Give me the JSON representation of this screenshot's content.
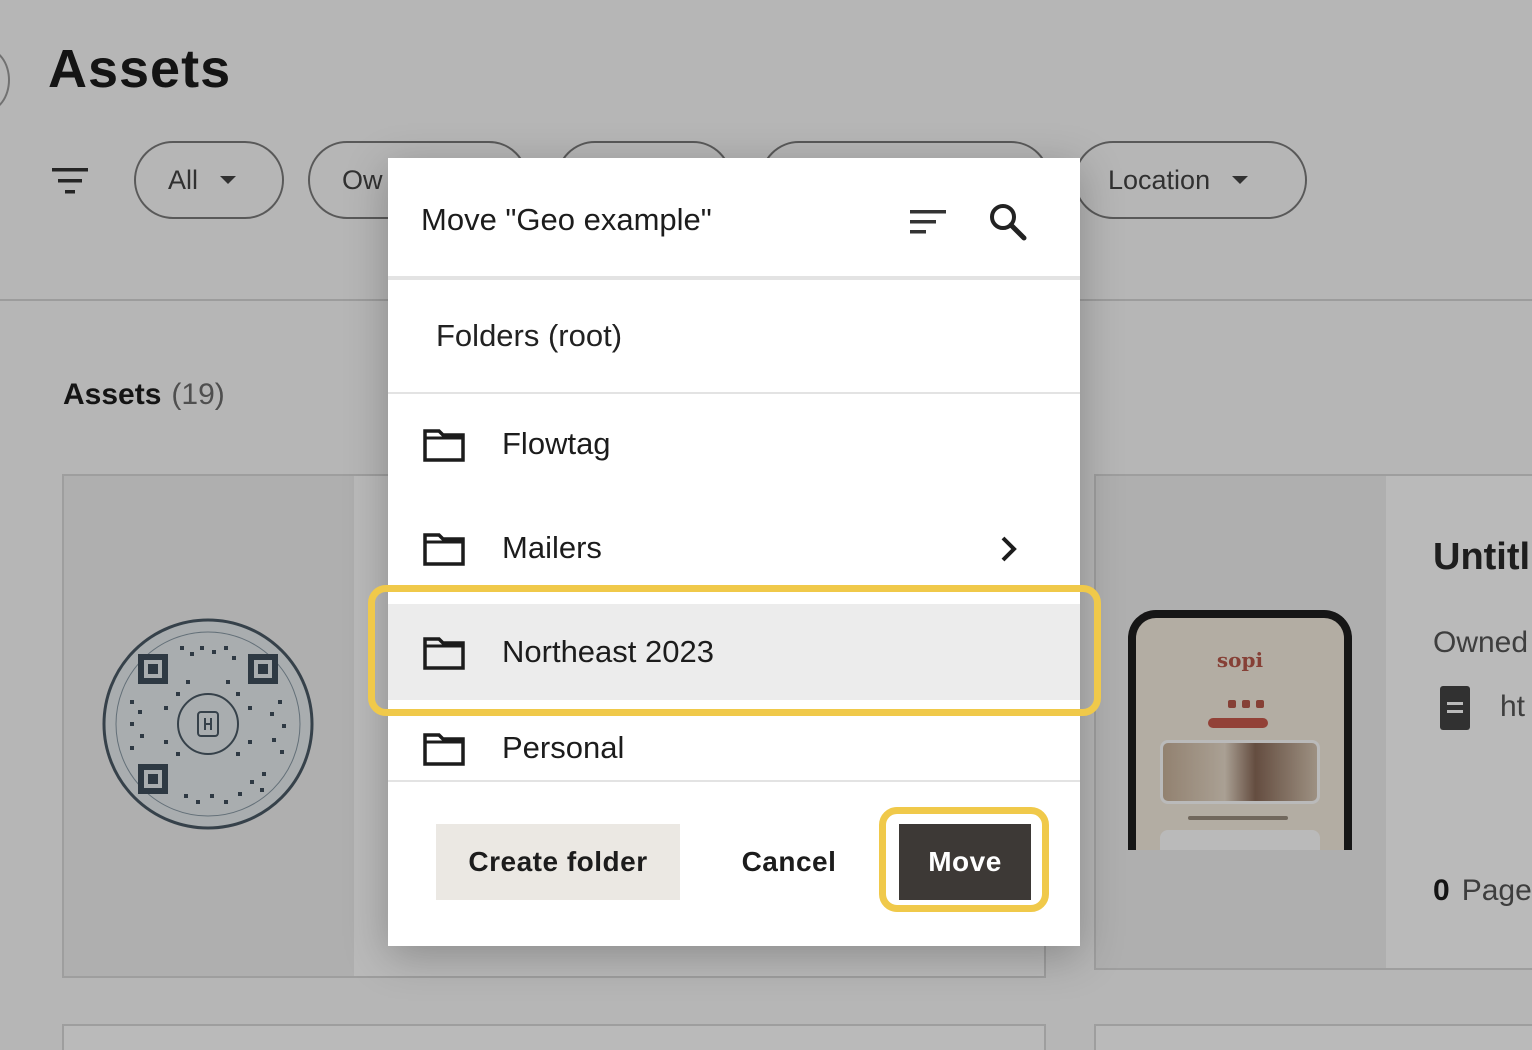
{
  "page": {
    "title": "Assets",
    "chips": [
      {
        "label": "All"
      },
      {
        "label": "Ow"
      },
      {
        "label": ""
      },
      {
        "label": ""
      },
      {
        "label": "Location"
      }
    ],
    "assets_heading": "Assets",
    "assets_count": "(19)",
    "card_right": {
      "title": "Untitl",
      "owned": "Owned",
      "link": "ht",
      "pages_count": "0",
      "pages_label": "Page"
    },
    "phone_brand": "sopi"
  },
  "dialog": {
    "title": "Move \"Geo example\"",
    "root_label": "Folders (root)",
    "folders": [
      {
        "label": "Flowtag",
        "has_children": false,
        "selected": false
      },
      {
        "label": "Mailers",
        "has_children": true,
        "selected": false
      },
      {
        "label": "Northeast 2023",
        "has_children": false,
        "selected": true
      },
      {
        "label": "Personal",
        "has_children": false,
        "selected": false
      }
    ],
    "create_folder_label": "Create folder",
    "cancel_label": "Cancel",
    "move_label": "Move"
  },
  "colors": {
    "highlight": "#f0c94a",
    "move_button": "#3d3936",
    "create_button": "#ebe8e3",
    "selected_row": "#ececec",
    "scrim": "rgba(0,0,0,0.27)"
  },
  "icons": {
    "filter": "filter-lines-icon",
    "sort": "sort-icon",
    "search": "search-icon",
    "folder": "folder-icon",
    "chevron": "chevron-right-icon"
  }
}
